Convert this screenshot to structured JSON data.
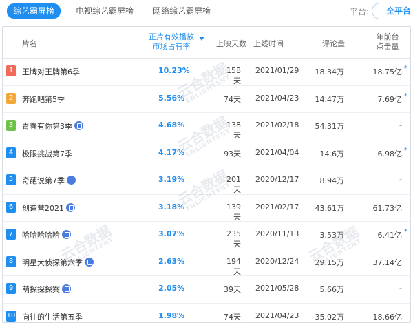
{
  "tabs": [
    "综艺霸屏榜",
    "电视综艺霸屏榜",
    "网络综艺霸屏榜"
  ],
  "platform": {
    "label": "平台:",
    "value": "全平台"
  },
  "headers": {
    "name": "片名",
    "share_line1": "正片有效播放",
    "share_line2": "市场占有率",
    "days": "上映天数",
    "date": "上线时间",
    "comments": "评论量",
    "hits_line1": "年前台",
    "hits_line2": "点击量"
  },
  "rank_colors": {
    "1": "#f0695a",
    "2": "#f5a83a",
    "3": "#6ec24a",
    "other": "#1f8ef1"
  },
  "rows": [
    {
      "rank": "1",
      "title": "王牌对王牌第6季",
      "badge": false,
      "share": "10.23%",
      "days": "158天",
      "date": "2021/01/29",
      "comments": "18.34万",
      "hits": "18.75亿",
      "star": true
    },
    {
      "rank": "2",
      "title": "奔跑吧第5季",
      "badge": false,
      "share": "5.56%",
      "days": "74天",
      "date": "2021/04/23",
      "comments": "14.47万",
      "hits": "7.69亿",
      "star": true
    },
    {
      "rank": "3",
      "title": "青春有你第3季",
      "badge": true,
      "share": "4.68%",
      "days": "138天",
      "date": "2021/02/18",
      "comments": "54.31万",
      "hits": "-",
      "star": false
    },
    {
      "rank": "4",
      "title": "极限挑战第7季",
      "badge": false,
      "share": "4.17%",
      "days": "93天",
      "date": "2021/04/04",
      "comments": "14.6万",
      "hits": "6.98亿",
      "star": true
    },
    {
      "rank": "5",
      "title": "奇葩说第7季",
      "badge": true,
      "share": "3.19%",
      "days": "201天",
      "date": "2020/12/17",
      "comments": "8.94万",
      "hits": "-",
      "star": false
    },
    {
      "rank": "6",
      "title": "创造营2021",
      "badge": true,
      "share": "3.18%",
      "days": "139天",
      "date": "2021/02/17",
      "comments": "43.61万",
      "hits": "61.73亿",
      "star": false
    },
    {
      "rank": "7",
      "title": "哈哈哈哈哈",
      "badge": true,
      "share": "3.07%",
      "days": "235天",
      "date": "2020/11/13",
      "comments": "3.53万",
      "hits": "6.41亿",
      "star": true
    },
    {
      "rank": "8",
      "title": "明星大侦探第六季",
      "badge": true,
      "share": "2.63%",
      "days": "194天",
      "date": "2020/12/24",
      "comments": "29.15万",
      "hits": "37.14亿",
      "star": false
    },
    {
      "rank": "9",
      "title": "萌探探探案",
      "badge": true,
      "share": "2.05%",
      "days": "39天",
      "date": "2021/05/28",
      "comments": "5.66万",
      "hits": "-",
      "star": false
    },
    {
      "rank": "10",
      "title": "向往的生活第五季",
      "badge": false,
      "share": "1.98%",
      "days": "74天",
      "date": "2021/04/23",
      "comments": "35.02万",
      "hits": "18.66亿",
      "star": false
    }
  ],
  "watermark": {
    "text": "云合数据",
    "sub": "ENLIGHTENT"
  }
}
